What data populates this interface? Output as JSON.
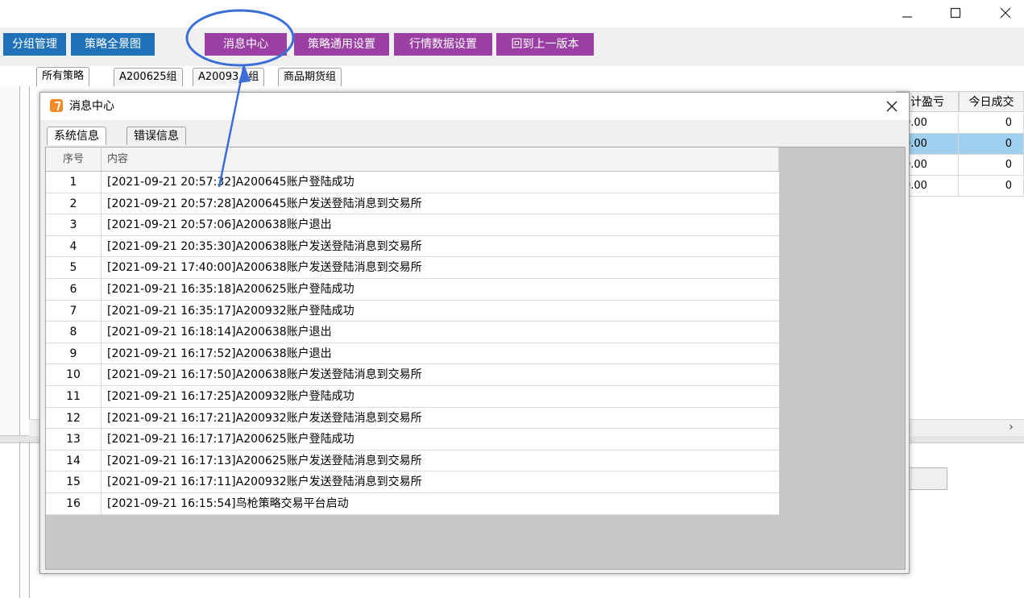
{
  "window": {
    "minimize_icon": "minimize-icon",
    "maximize_icon": "maximize-icon",
    "close_icon": "close-icon"
  },
  "toolbar": {
    "buttons": [
      {
        "label": "分组管理"
      },
      {
        "label": "策略全景图"
      },
      {
        "label": "消息中心"
      },
      {
        "label": "策略通用设置"
      },
      {
        "label": "行情数据设置"
      },
      {
        "label": "回到上一版本"
      }
    ],
    "colors": {
      "blue": "#1f72b8",
      "purple": "#9b3fa5"
    }
  },
  "main_tabs": [
    {
      "label": "所有策略"
    },
    {
      "label": "A200625组"
    },
    {
      "label": "A20093"
    },
    {
      "label": "组"
    },
    {
      "label": "商品期货组"
    }
  ],
  "background_grid": {
    "headers": [
      "计盈亏",
      "今日成交"
    ],
    "rows": [
      {
        "pnl": "0.00",
        "today": "0",
        "selected": false
      },
      {
        "pnl": "0.00",
        "today": "0",
        "selected": true
      },
      {
        "pnl": "0.00",
        "today": "0",
        "selected": false
      },
      {
        "pnl": "0.00",
        "today": "0",
        "selected": false
      }
    ],
    "scroll_right": "›"
  },
  "dialog": {
    "title": "消息中心",
    "tabs": [
      {
        "label": "系统信息"
      },
      {
        "label": "错误信息"
      }
    ],
    "columns": {
      "index": "序号",
      "content": "内容"
    },
    "rows": [
      {
        "index": "1",
        "content": "[2021-09-21 20:57:32]A200645账户登陆成功"
      },
      {
        "index": "2",
        "content": "[2021-09-21 20:57:28]A200645账户发送登陆消息到交易所"
      },
      {
        "index": "3",
        "content": "[2021-09-21 20:57:06]A200638账户退出"
      },
      {
        "index": "4",
        "content": "[2021-09-21 20:35:30]A200638账户发送登陆消息到交易所"
      },
      {
        "index": "5",
        "content": "[2021-09-21 17:40:00]A200638账户发送登陆消息到交易所"
      },
      {
        "index": "6",
        "content": "[2021-09-21 16:35:18]A200625账户登陆成功"
      },
      {
        "index": "7",
        "content": "[2021-09-21 16:35:17]A200932账户登陆成功"
      },
      {
        "index": "8",
        "content": "[2021-09-21 16:18:14]A200638账户退出"
      },
      {
        "index": "9",
        "content": "[2021-09-21 16:17:52]A200638账户退出"
      },
      {
        "index": "10",
        "content": "[2021-09-21 16:17:50]A200638账户发送登陆消息到交易所"
      },
      {
        "index": "11",
        "content": "[2021-09-21 16:17:25]A200932账户登陆成功"
      },
      {
        "index": "12",
        "content": "[2021-09-21 16:17:21]A200932账户发送登陆消息到交易所"
      },
      {
        "index": "13",
        "content": "[2021-09-21 16:17:17]A200625账户登陆成功"
      },
      {
        "index": "14",
        "content": "[2021-09-21 16:17:13]A200625账户发送登陆消息到交易所"
      },
      {
        "index": "15",
        "content": "[2021-09-21 16:17:11]A200932账户发送登陆消息到交易所"
      },
      {
        "index": "16",
        "content": "[2021-09-21 16:15:54]鸟枪策略交易平台启动"
      }
    ]
  },
  "annotation": {
    "color": "#3a6fd8"
  }
}
